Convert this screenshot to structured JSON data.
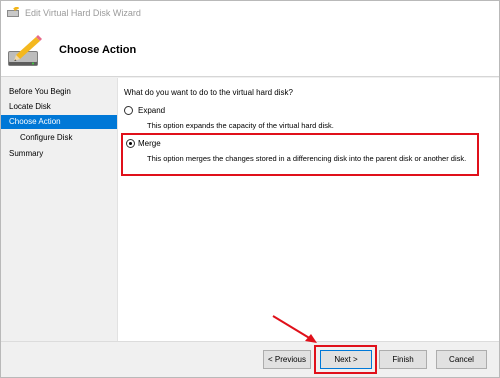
{
  "window": {
    "title": "Edit Virtual Hard Disk Wizard"
  },
  "header": {
    "title": "Choose Action",
    "icon": "pencil-disk-icon"
  },
  "sidebar": {
    "items": [
      {
        "label": "Before You Begin",
        "active": false,
        "indent": false
      },
      {
        "label": "Locate Disk",
        "active": false,
        "indent": false
      },
      {
        "label": "Choose Action",
        "active": true,
        "indent": false
      },
      {
        "label": "Configure Disk",
        "active": false,
        "indent": true
      },
      {
        "label": "Summary",
        "active": false,
        "indent": false
      }
    ]
  },
  "main": {
    "question": "What do you want to do to the virtual hard disk?",
    "options": [
      {
        "label": "Expand",
        "description": "This option expands the capacity of the virtual hard disk.",
        "selected": false
      },
      {
        "label": "Merge",
        "description": "This option merges the changes stored in a differencing disk into the parent disk or another disk.",
        "selected": true
      }
    ]
  },
  "footer": {
    "previous_label": "< Previous",
    "next_label": "Next >",
    "finish_label": "Finish",
    "cancel_label": "Cancel"
  },
  "colors": {
    "accent": "#0078d7",
    "annotation": "#e0101a"
  }
}
